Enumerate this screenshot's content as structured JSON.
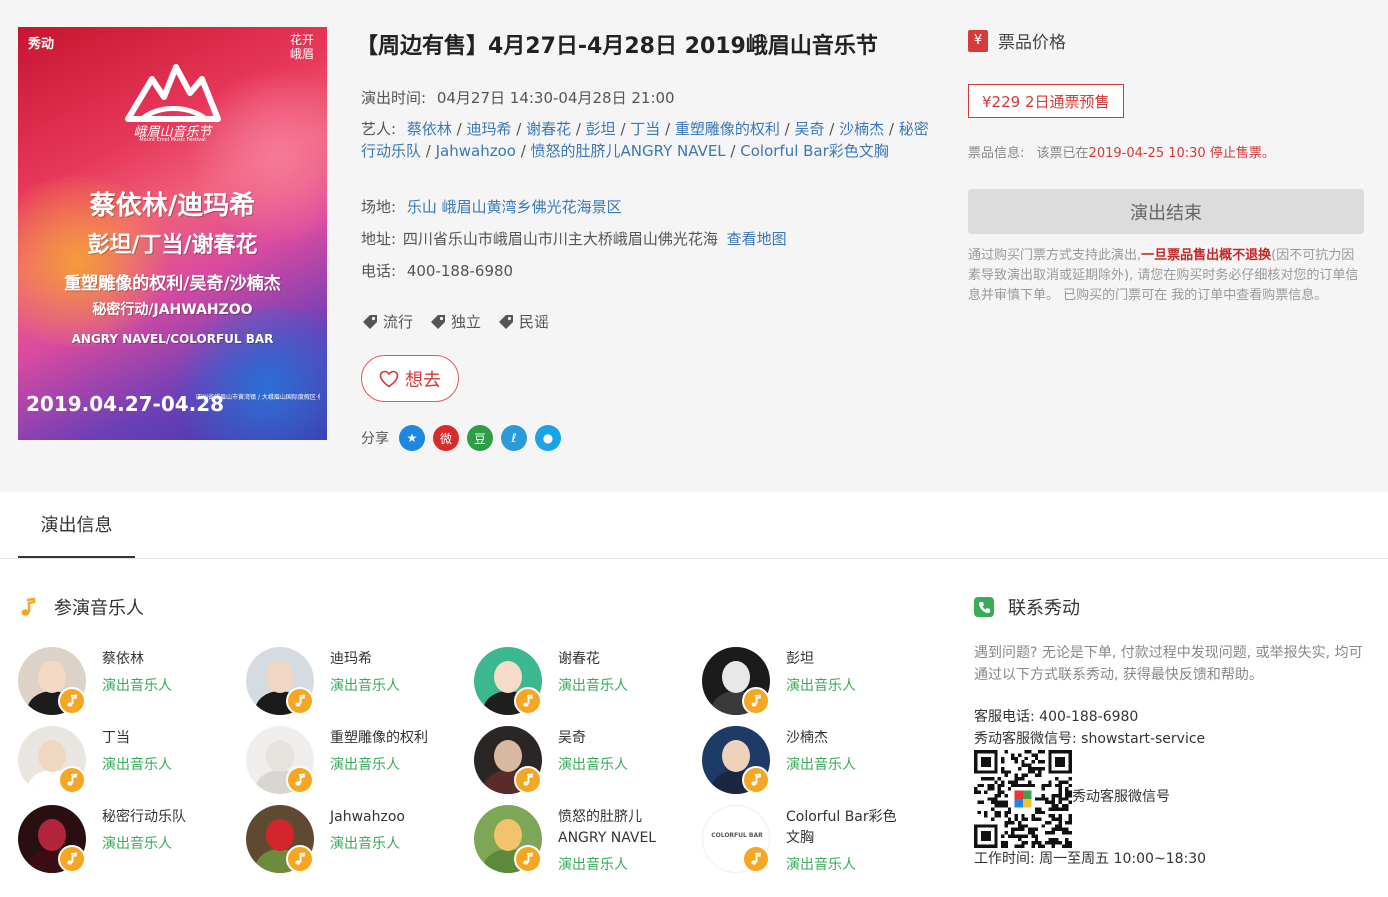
{
  "poster": {
    "brand": "秀动",
    "corner": "花开峨眉",
    "festival": "峨眉山音乐节",
    "festival_en": "Mount Emei Music Festival",
    "lines": [
      "蔡依林/迪玛希",
      "彭坦/丁当/谢春花",
      "重塑雕像的权利/吴奇/沙楠杰",
      "秘密行动/JAHWAHZOO",
      "ANGRY NAVEL/COLORFUL BAR"
    ],
    "date": "2019.04.27-04.28",
    "addr": "四川省峨眉山市黄湾镇 / 大峨眉山国际度假区·佛光花海"
  },
  "event": {
    "title": "【周边有售】4月27日-4月28日 2019峨眉山音乐节",
    "time_label": "演出时间:",
    "time_value": "04月27日 14:30-04月28日 21:00",
    "artists_label": "艺人:",
    "artists": [
      "蔡依林",
      "迪玛希",
      "谢春花",
      "彭坦",
      "丁当",
      "重塑雕像的权利",
      "吴奇",
      "沙楠杰",
      "秘密行动乐队",
      "Jahwahzoo",
      "愤怒的肚脐儿ANGRY NAVEL",
      "Colorful Bar彩色文胸"
    ],
    "sep": " / ",
    "venue_label": "场地:",
    "venue_value": "乐山 峨眉山黄湾乡佛光花海景区",
    "addr_label": "地址:",
    "addr_value": "四川省乐山市峨眉山市川主大桥峨眉山佛光花海",
    "map_link": "查看地图",
    "tel_label": "电话:",
    "tel_value": "400-188-6980",
    "tags": [
      "流行",
      "独立",
      "民谣"
    ],
    "want_label": "想去",
    "share_label": "分享",
    "share_icons": [
      {
        "name": "qzone",
        "glyph": "★",
        "color": "#1e87e0"
      },
      {
        "name": "weibo",
        "glyph": "微",
        "color": "#d92b2b"
      },
      {
        "name": "douban",
        "glyph": "豆",
        "color": "#2d9e45"
      },
      {
        "name": "tencent",
        "glyph": "ℓ",
        "color": "#2a9ad8"
      },
      {
        "name": "qq",
        "glyph": "●",
        "color": "#1aa3e6"
      }
    ]
  },
  "price": {
    "yen_badge": "¥",
    "heading": "票品价格",
    "option": "¥229 2日通票预售",
    "info_prefix": "票品信息:",
    "info_mid": "该票已在",
    "info_red": "2019-04-25 10:30 停止售票。",
    "ended": "演出结束",
    "notice_a": "通过购买门票方式支持此演出,",
    "notice_red": "一旦票品售出概不退换",
    "notice_b": "(因不可抗力因素导致演出取消或延期除外), 请您在购买时务必仔细核对您的订单信息并审慎下单。 已购买的门票可在 我的订单中查看购票信息。"
  },
  "tabs": {
    "info": "演出信息"
  },
  "musicians": {
    "heading": "参演音乐人",
    "role": "演出音乐人",
    "items": [
      {
        "name": "蔡依林",
        "bg": "#ddd2c8",
        "head": "#f3d9c4",
        "body": "#1c1c1c"
      },
      {
        "name": "迪玛希",
        "bg": "#d6dbe2",
        "head": "#f1d6c3",
        "body": "#1a1a1a"
      },
      {
        "name": "谢春花",
        "bg": "#3bb890",
        "head": "#f4dcc8",
        "body": "#1f1f1f"
      },
      {
        "name": "彭坦",
        "bg": "#1b1b1b",
        "head": "#e8e8e8",
        "body": "#3a3a3a"
      },
      {
        "name": "丁当",
        "bg": "#e9e5e0",
        "head": "#f0d8c0",
        "body": "#ffffff"
      },
      {
        "name": "重塑雕像的权利",
        "bg": "#efeeed",
        "head": "#e6e2dd",
        "body": "#d9d5d0"
      },
      {
        "name": "吴奇",
        "bg": "#2a2626",
        "head": "#d9b8a2",
        "body": "#5b2a2a"
      },
      {
        "name": "沙楠杰",
        "bg": "#1e3a66",
        "head": "#efd2bc",
        "body": "#1b2640"
      },
      {
        "name": "秘密行动乐队",
        "bg": "#2a0f12",
        "head": "#b0253a",
        "body": "#3a0d12"
      },
      {
        "name": "Jahwahzoo",
        "bg": "#5f4a31",
        "head": "#d4242c",
        "body": "#6e8a3d"
      },
      {
        "name": "愤怒的肚脐儿ANGRY NAVEL",
        "name2": "ANGRY NAVEL",
        "name1": "愤怒的肚脐儿",
        "bg": "#7da656",
        "head": "#f1c36c",
        "body": "#5d8a3a"
      },
      {
        "name": "Colorful Bar彩色文胸",
        "name1": "Colorful Bar彩色",
        "name2": "文胸",
        "bg": "#ffffff",
        "head": "#ffffff",
        "body": "#ffffff",
        "logo": "COLORFUL BAR"
      }
    ]
  },
  "contact": {
    "heading": "联系秀动",
    "text": "遇到问题? 无论是下单, 付款过程中发现问题, 或举报失实, 均可通过以下方式联系秀动, 获得最快反馈和帮助。",
    "tel": "客服电话: 400-188-6980",
    "wx": "秀动客服微信号: showstart-service",
    "qr_label": "秀动客服微信号",
    "hours": "工作时间: 周一至周五 10:00~18:30"
  }
}
